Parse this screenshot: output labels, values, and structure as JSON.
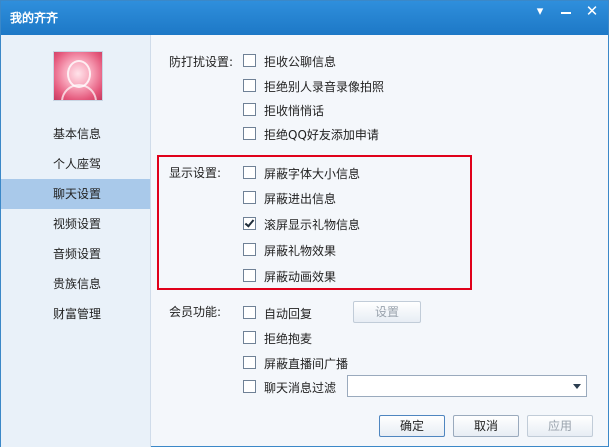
{
  "window": {
    "title": "我的齐齐",
    "title_buttons": [
      "settings",
      "minimize",
      "close"
    ]
  },
  "sidebar": {
    "items": [
      {
        "label": "基本信息",
        "active": false
      },
      {
        "label": "个人座驾",
        "active": false
      },
      {
        "label": "聊天设置",
        "active": true
      },
      {
        "label": "视频设置",
        "active": false
      },
      {
        "label": "音频设置",
        "active": false
      },
      {
        "label": "贵族信息",
        "active": false
      },
      {
        "label": "财富管理",
        "active": false
      }
    ]
  },
  "anti_disturb": {
    "label": "防打扰设置:",
    "options": [
      {
        "label": "拒收公聊信息",
        "checked": false
      },
      {
        "label": "拒绝别人录音录像拍照",
        "checked": false
      },
      {
        "label": "拒收悄悄话",
        "checked": false
      },
      {
        "label": "拒绝QQ好友添加申请",
        "checked": false
      }
    ]
  },
  "display": {
    "label": "显示设置:",
    "options": [
      {
        "label": "屏蔽字体大小信息",
        "checked": false
      },
      {
        "label": "屏蔽进出信息",
        "checked": false
      },
      {
        "label": "滚屏显示礼物信息",
        "checked": true
      },
      {
        "label": "屏蔽礼物效果",
        "checked": false
      },
      {
        "label": "屏蔽动画效果",
        "checked": false
      }
    ]
  },
  "member": {
    "label": "会员功能:",
    "options": [
      {
        "label": "自动回复",
        "checked": false
      },
      {
        "label": "拒绝抱麦",
        "checked": false
      },
      {
        "label": "屏蔽直播间广播",
        "checked": false
      },
      {
        "label": "聊天消息过滤",
        "checked": false
      }
    ],
    "settings_button": "设置",
    "filter_select_value": ""
  },
  "footer": {
    "ok": "确定",
    "cancel": "取消",
    "apply": "应用"
  },
  "colors": {
    "titlebar": "#1d78c6",
    "sidebar_active": "#a9c9ea",
    "highlight": "#e0001a"
  }
}
